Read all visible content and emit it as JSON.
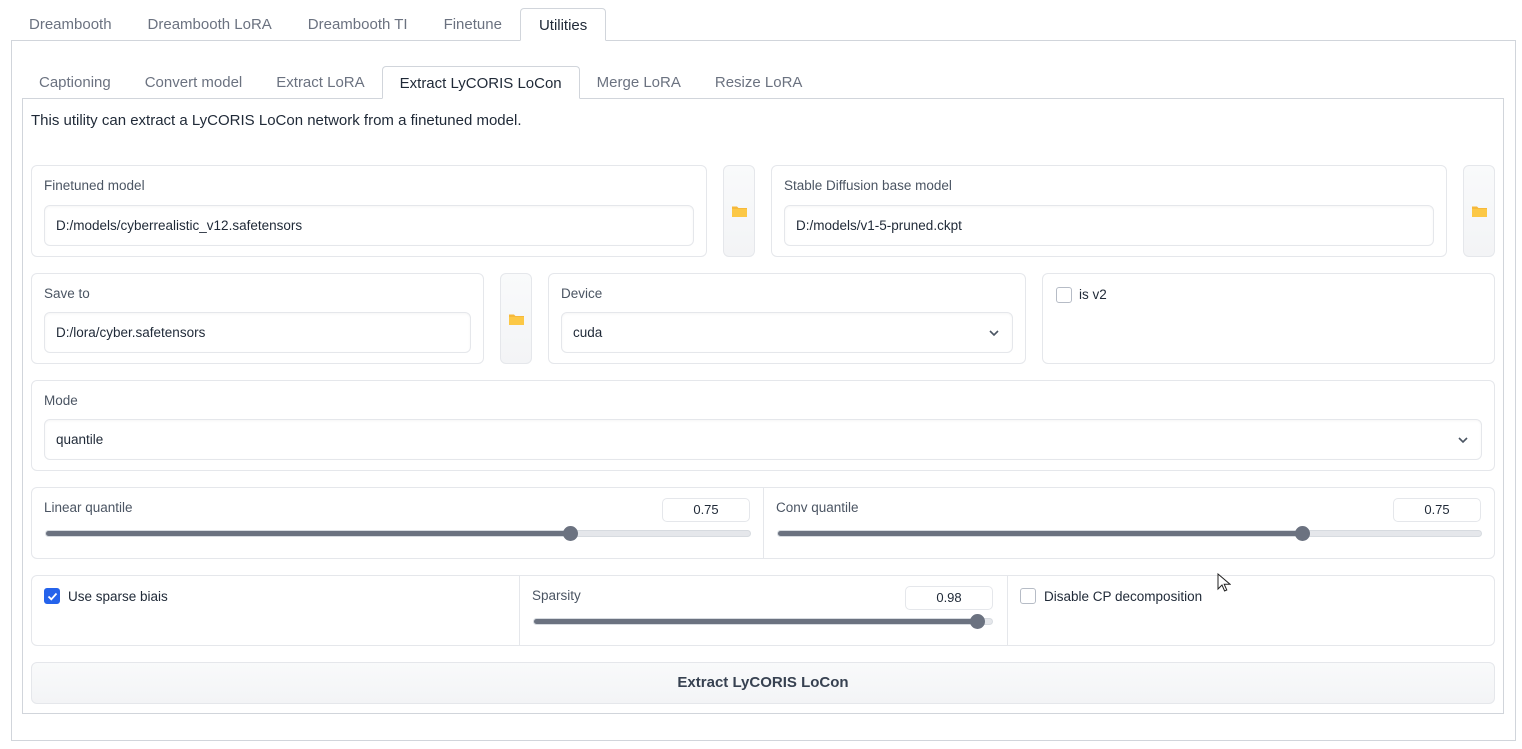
{
  "top_tabs": [
    "Dreambooth",
    "Dreambooth LoRA",
    "Dreambooth TI",
    "Finetune",
    "Utilities"
  ],
  "top_tab_active": "Utilities",
  "sub_tabs": [
    "Captioning",
    "Convert model",
    "Extract LoRA",
    "Extract LyCORIS LoCon",
    "Merge LoRA",
    "Resize LoRA"
  ],
  "sub_tab_active": "Extract LyCORIS LoCon",
  "intro": "This utility can extract a LyCORIS LoCon network from a finetuned model.",
  "finetuned_model": {
    "label": "Finetuned model",
    "value": "D:/models/cyberrealistic_v12.safetensors"
  },
  "base_model": {
    "label": "Stable Diffusion base model",
    "value": "D:/models/v1-5-pruned.ckpt"
  },
  "save_to": {
    "label": "Save to",
    "value": "D:/lora/cyber.safetensors"
  },
  "device": {
    "label": "Device",
    "value": "cuda"
  },
  "is_v2": {
    "label": "is v2",
    "checked": false
  },
  "mode": {
    "label": "Mode",
    "value": "quantile"
  },
  "linear_quantile": {
    "label": "Linear quantile",
    "value": "0.75",
    "fraction": 0.745
  },
  "conv_quantile": {
    "label": "Conv quantile",
    "value": "0.75",
    "fraction": 0.745
  },
  "use_sparse_bias": {
    "label": "Use sparse biais",
    "checked": true
  },
  "sparsity": {
    "label": "Sparsity",
    "value": "0.98",
    "fraction": 0.967
  },
  "disable_cp": {
    "label": "Disable CP decomposition",
    "checked": false
  },
  "run_button": "Extract LyCORIS LoCon",
  "icons": {
    "folder": "folder-icon",
    "chevron": "chevron-down-icon",
    "check": "check-icon",
    "cursor": "mouse-cursor-icon"
  },
  "colors": {
    "folder": "#f6b93b",
    "accent": "#2563eb",
    "slider": "#6b7280"
  }
}
